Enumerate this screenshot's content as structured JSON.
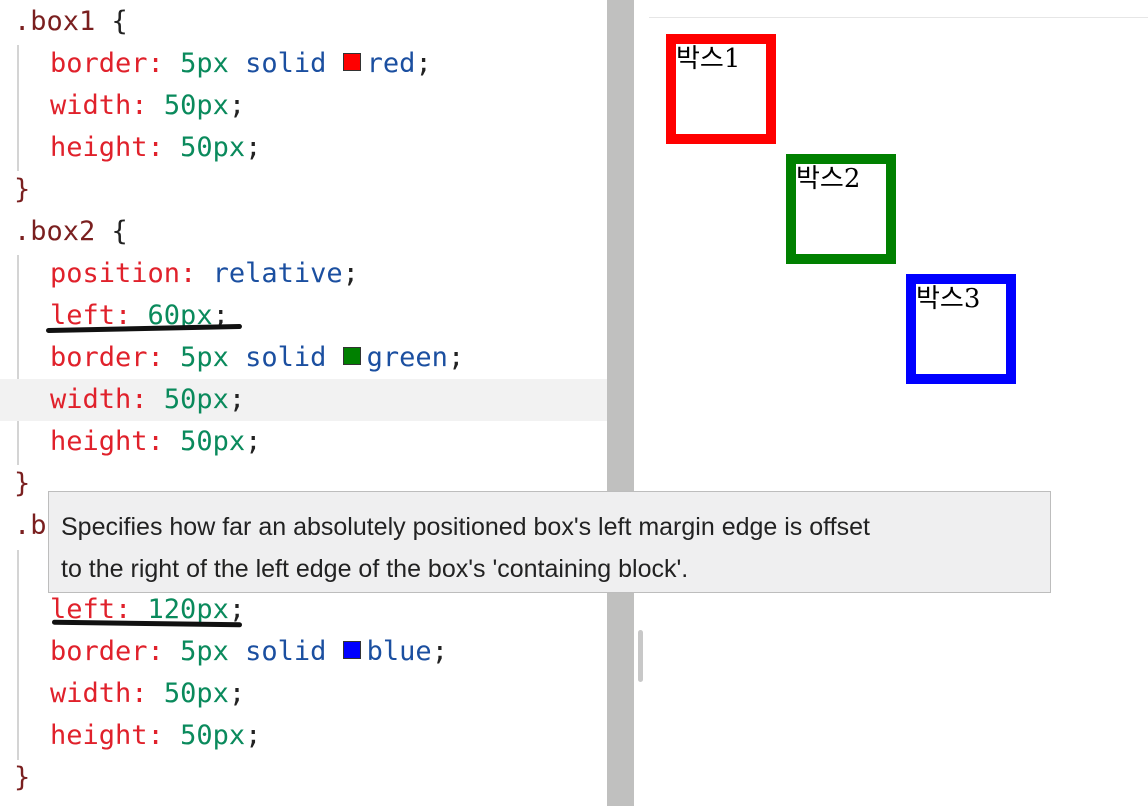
{
  "editor": {
    "box1": {
      "selector": ".box1",
      "open": " {",
      "border_prop": "border:",
      "border_width": "5px",
      "border_style": "solid",
      "border_color": "red",
      "border_swatch": "#ff0000",
      "width_prop": "width:",
      "width_val": "50px",
      "height_prop": "height:",
      "height_val": "50px",
      "close": "}"
    },
    "box2": {
      "selector": ".box2",
      "open": " {",
      "position_prop": "position:",
      "position_val": "relative",
      "left_prop": "left:",
      "left_val": "60px",
      "border_prop": "border:",
      "border_width": "5px",
      "border_style": "solid",
      "border_color": "green",
      "border_swatch": "#008000",
      "width_prop": "width:",
      "width_val": "50px",
      "height_prop": "height:",
      "height_val": "50px",
      "close": "}"
    },
    "box3": {
      "selector_partial": ".b",
      "left_prop": "left:",
      "left_val": "120px",
      "border_prop": "border:",
      "border_width": "5px",
      "border_style": "solid",
      "border_color": "blue",
      "border_swatch": "#0000ff",
      "width_prop": "width:",
      "width_val": "50px",
      "height_prop": "height:",
      "height_val": "50px",
      "close": "}"
    },
    "semicolon": ";"
  },
  "tooltip": {
    "line1": "Specifies how far an absolutely positioned box's left margin edge is offset",
    "line2": "to the right of the left edge of the box's 'containing block'."
  },
  "preview": {
    "boxes": [
      {
        "label": "박스1",
        "color": "#ff0000"
      },
      {
        "label": "박스2",
        "color": "#008000"
      },
      {
        "label": "박스3",
        "color": "#0000ff"
      }
    ]
  }
}
